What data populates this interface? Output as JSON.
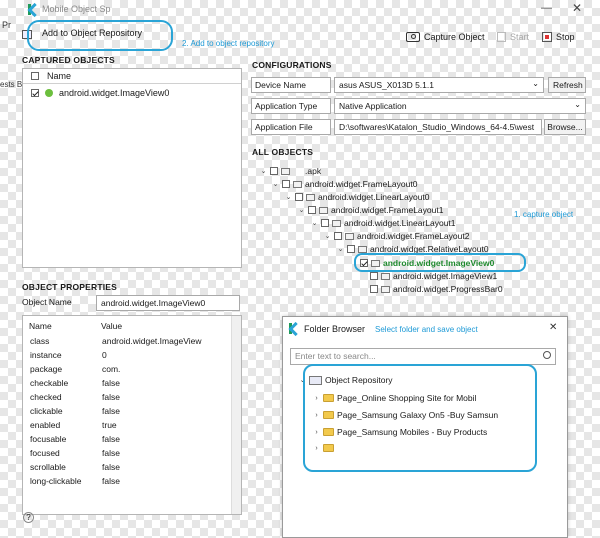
{
  "window": {
    "title": "Mobile Object Sp",
    "left_partial_labels": [
      "Pr",
      "ests B"
    ]
  },
  "toolbar": {
    "add_repo_label": "Add to Object Repository",
    "capture_label": "Capture Object",
    "start_label": "Start",
    "stop_label": "Stop"
  },
  "annotations": {
    "step2": "2. Add to object repository",
    "step1": "1. capture object",
    "folder_hint": "Select folder and save object"
  },
  "captured": {
    "header": "CAPTURED OBJECTS",
    "col_name": "Name",
    "items": [
      {
        "label": "android.widget.ImageView0"
      }
    ]
  },
  "config": {
    "header": "CONFIGURATIONS",
    "device_label": "Device Name",
    "device_value": "asus ASUS_X013D 5.1.1",
    "refresh_label": "Refresh",
    "apptype_label": "Application Type",
    "apptype_value": "Native Application",
    "appfile_label": "Application File",
    "appfile_value": "D:\\softwares\\Katalon_Studio_Windows_64-4.5\\west",
    "browse_label": "Browse..."
  },
  "all_objects": {
    "header": "ALL OBJECTS",
    "nodes": [
      {
        "label": ".apk"
      },
      {
        "label": "android.widget.FrameLayout0"
      },
      {
        "label": "android.widget.LinearLayout0"
      },
      {
        "label": "android.widget.FrameLayout1"
      },
      {
        "label": "android.widget.LinearLayout1"
      },
      {
        "label": "android.widget.FrameLayout2"
      },
      {
        "label": "android.widget.RelativeLayout0"
      },
      {
        "label": "android.widget.ImageView0"
      },
      {
        "label": "android.widget.ImageView1"
      },
      {
        "label": "android.widget.ProgressBar0"
      }
    ]
  },
  "properties": {
    "header": "OBJECT PROPERTIES",
    "name_label": "Object Name",
    "name_value": "android.widget.ImageView0",
    "col_name": "Name",
    "col_value": "Value",
    "rows": [
      {
        "name": "class",
        "value": "android.widget.ImageView"
      },
      {
        "name": "instance",
        "value": "0"
      },
      {
        "name": "package",
        "value": "com."
      },
      {
        "name": "checkable",
        "value": "false"
      },
      {
        "name": "checked",
        "value": "false"
      },
      {
        "name": "clickable",
        "value": "false"
      },
      {
        "name": "enabled",
        "value": "true"
      },
      {
        "name": "focusable",
        "value": "false"
      },
      {
        "name": "focused",
        "value": "false"
      },
      {
        "name": "scrollable",
        "value": "false"
      },
      {
        "name": "long-clickable",
        "value": "false"
      }
    ]
  },
  "folder_browser": {
    "title": "Folder Browser",
    "search_placeholder": "Enter text to search...",
    "root": "Object Repository",
    "items": [
      {
        "label": "Page_Online Shopping Site for Mobil"
      },
      {
        "label": "Page_Samsung Galaxy On5 -Buy Samsun"
      },
      {
        "label": "Page_Samsung Mobiles - Buy Products"
      },
      {
        "label": ""
      }
    ]
  },
  "colors": {
    "annotation": "#2aa4d6",
    "highlight_text": "#1f8a2e"
  }
}
